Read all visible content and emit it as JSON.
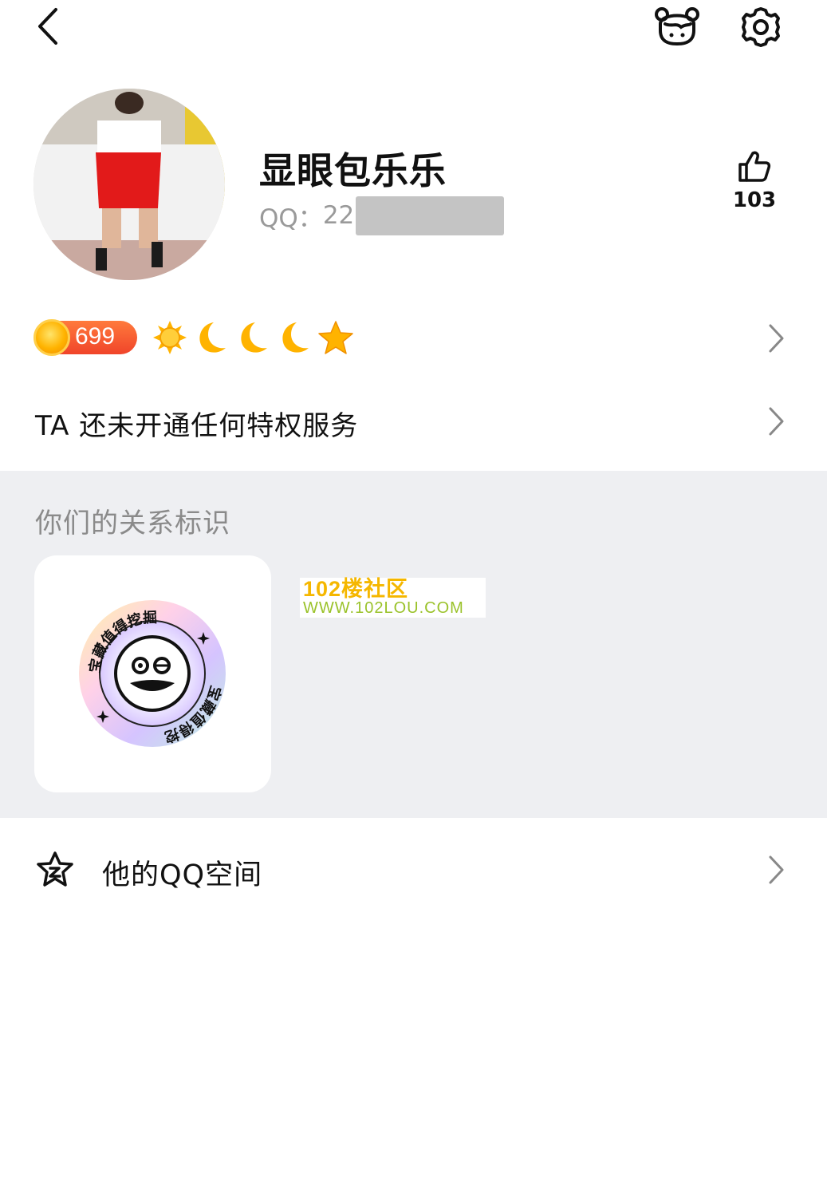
{
  "header": {
    "back_icon": "chevron-left-icon",
    "pet_icon": "pet-icon",
    "settings_icon": "gear-icon"
  },
  "profile": {
    "avatar": "avatar-photo",
    "nickname": "显眼包乐乐",
    "qq_label": "QQ：",
    "qq_value_visible": "22",
    "likes_icon": "thumbs-up-icon",
    "likes": "103"
  },
  "level": {
    "value": "699",
    "icons": [
      "sun-icon",
      "moon-icon",
      "moon-icon",
      "moon-icon",
      "star-icon"
    ]
  },
  "privilege": {
    "text": "TA 还未开通任何特权服务"
  },
  "relation": {
    "title": "你们的关系标识",
    "badge_text": "宝藏值得挖掘"
  },
  "watermark": {
    "line1": "102楼社区",
    "line2": "WWW.102LOU.COM"
  },
  "qzone": {
    "icon": "qzone-star-icon",
    "label": "他的QQ空间"
  },
  "colors": {
    "level_badge": "#f0442a",
    "section_bg": "#eeeff2",
    "gold": "#ffb300"
  }
}
